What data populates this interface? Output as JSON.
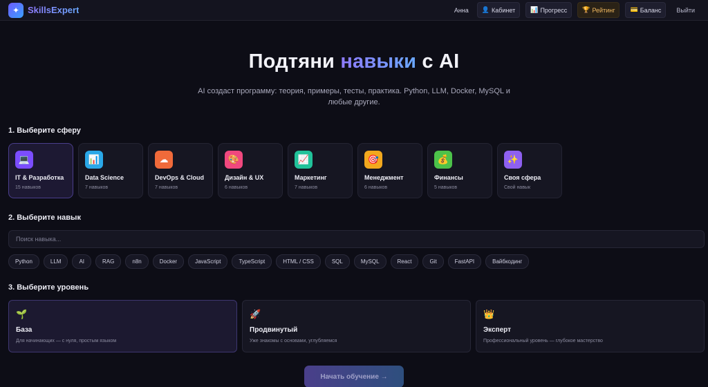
{
  "header": {
    "logo_icon": "✦",
    "app_name": "SkillsExpert",
    "user": "Анна",
    "nav": [
      {
        "icon": "👤",
        "label": "Кабинет"
      },
      {
        "icon": "📊",
        "label": "Прогресс"
      },
      {
        "icon": "🏆",
        "label": "Рейтинг"
      },
      {
        "icon": "💳",
        "label": "Баланс"
      }
    ],
    "logout": "Выйти"
  },
  "hero": {
    "title_pre": "Подтяни ",
    "title_accent": "навыки",
    "title_post": " с AI",
    "subtitle": "AI создаст программу: теория, примеры, тесты, практика. Python, LLM, Docker, MySQL и любые другие."
  },
  "step1": {
    "title": "1. Выберите сферу",
    "spheres": [
      {
        "icon": "💻",
        "name": "IT & Разработка",
        "count": "15 навыков",
        "color": "#7b4dff"
      },
      {
        "icon": "📊",
        "name": "Data Science",
        "count": "7 навыков",
        "color": "#2aa8e8"
      },
      {
        "icon": "☁",
        "name": "DevOps & Cloud",
        "count": "7 навыков",
        "color": "#f06a3a"
      },
      {
        "icon": "🎨",
        "name": "Дизайн & UX",
        "count": "6 навыков",
        "color": "#f0487e"
      },
      {
        "icon": "📈",
        "name": "Маркетинг",
        "count": "7 навыков",
        "color": "#21c29a"
      },
      {
        "icon": "🎯",
        "name": "Менеджмент",
        "count": "6 навыков",
        "color": "#f2a81e"
      },
      {
        "icon": "💰",
        "name": "Финансы",
        "count": "5 навыков",
        "color": "#4cc24a"
      },
      {
        "icon": "✨",
        "name": "Своя сфера",
        "count": "Свой навык",
        "color": "#8e60f0"
      }
    ]
  },
  "step2": {
    "title": "2. Выберите навык",
    "search_placeholder": "Поиск навыка...",
    "chips": [
      "Python",
      "LLM",
      "AI",
      "RAG",
      "n8n",
      "Docker",
      "JavaScript",
      "TypeScript",
      "HTML / CSS",
      "SQL",
      "MySQL",
      "React",
      "Git",
      "FastAPI",
      "Вайбкодинг"
    ]
  },
  "step3": {
    "title": "3. Выберите уровень",
    "levels": [
      {
        "icon": "🌱",
        "name": "База",
        "desc": "Для начинающих — с нуля, простым языком"
      },
      {
        "icon": "🚀",
        "name": "Продвинутый",
        "desc": "Уже знакомы с основами, углубляемся"
      },
      {
        "icon": "👑",
        "name": "Эксперт",
        "desc": "Профессиональный уровень — глубокое мастерство"
      }
    ]
  },
  "cta": "Начать обучение →"
}
